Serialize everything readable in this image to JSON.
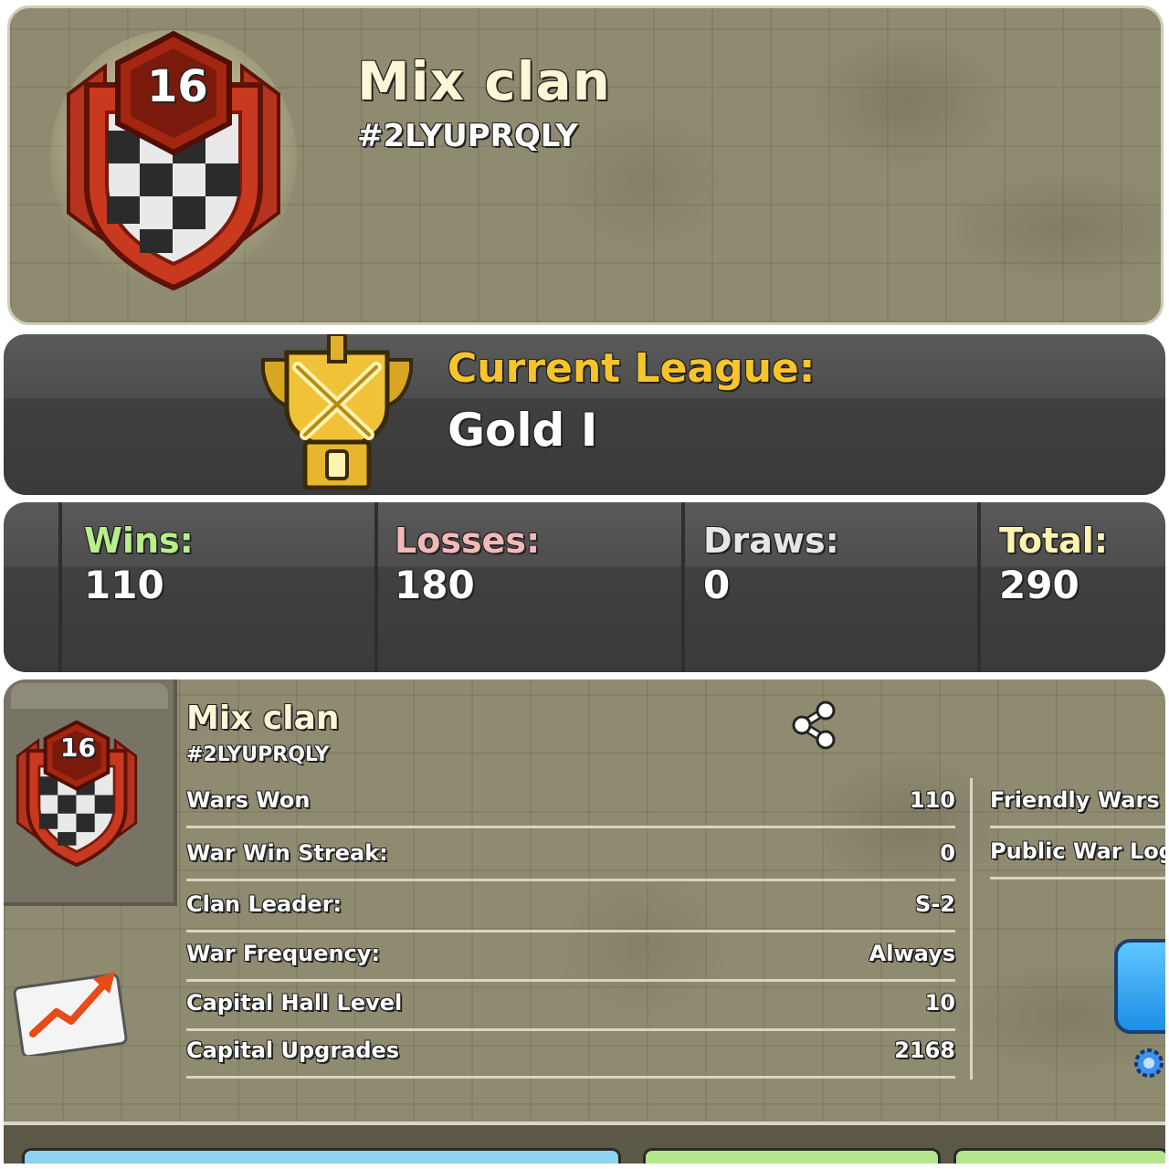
{
  "header": {
    "clan_level": "16",
    "clan_name": "Mix clan",
    "clan_tag": "#2LYUPRQLY"
  },
  "league": {
    "label": "Current League:",
    "value": "Gold I"
  },
  "war_stats": [
    {
      "label": "Wins:",
      "value": "110",
      "color": "#b6f08a"
    },
    {
      "label": "Losses:",
      "value": "180",
      "color": "#f5b8b8"
    },
    {
      "label": "Draws:",
      "value": "0",
      "color": "#e6e6e6"
    },
    {
      "label": "Total:",
      "value": "290",
      "color": "#fff3b0"
    }
  ],
  "details": {
    "clan_level": "16",
    "clan_name": "Mix clan",
    "clan_tag": "#2LYUPRQLY",
    "rows": [
      {
        "label": "Wars Won",
        "value": "110"
      },
      {
        "label": "War Win Streak:",
        "value": "0"
      },
      {
        "label": "Clan Leader:",
        "value": "S-2"
      },
      {
        "label": "War Frequency:",
        "value": "Always"
      },
      {
        "label": "Capital Hall Level",
        "value": "10"
      },
      {
        "label": "Capital Upgrades",
        "value": "2168"
      }
    ],
    "right_rows": [
      {
        "label": "Friendly Wars"
      },
      {
        "label": "Public War Log"
      }
    ]
  }
}
